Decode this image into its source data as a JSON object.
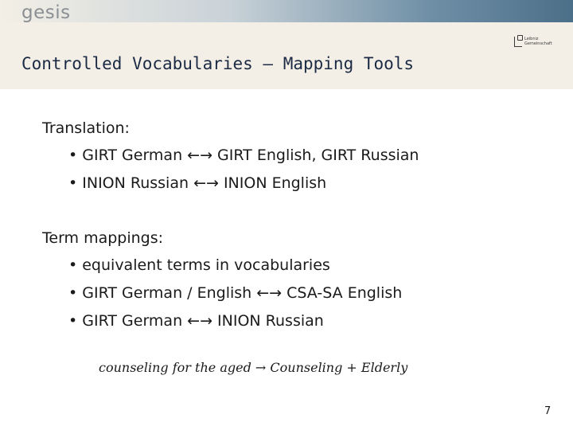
{
  "brand": "gesis",
  "logo_text": [
    "Leibniz",
    "Gemeinschaft"
  ],
  "title": "Controlled Vocabularies – Mapping Tools",
  "sections": [
    {
      "heading": "Translation:",
      "bullets": [
        "• GIRT German ←→ GIRT English, GIRT Russian",
        "• INION Russian ←→ INION English"
      ]
    },
    {
      "heading": "Term mappings:",
      "bullets": [
        "• equivalent terms in vocabularies",
        "• GIRT German / English ←→ CSA-SA English",
        "• GIRT German  ←→ INION Russian"
      ]
    }
  ],
  "example": "counseling for the aged  → Counseling + Elderly",
  "page_number": "7"
}
